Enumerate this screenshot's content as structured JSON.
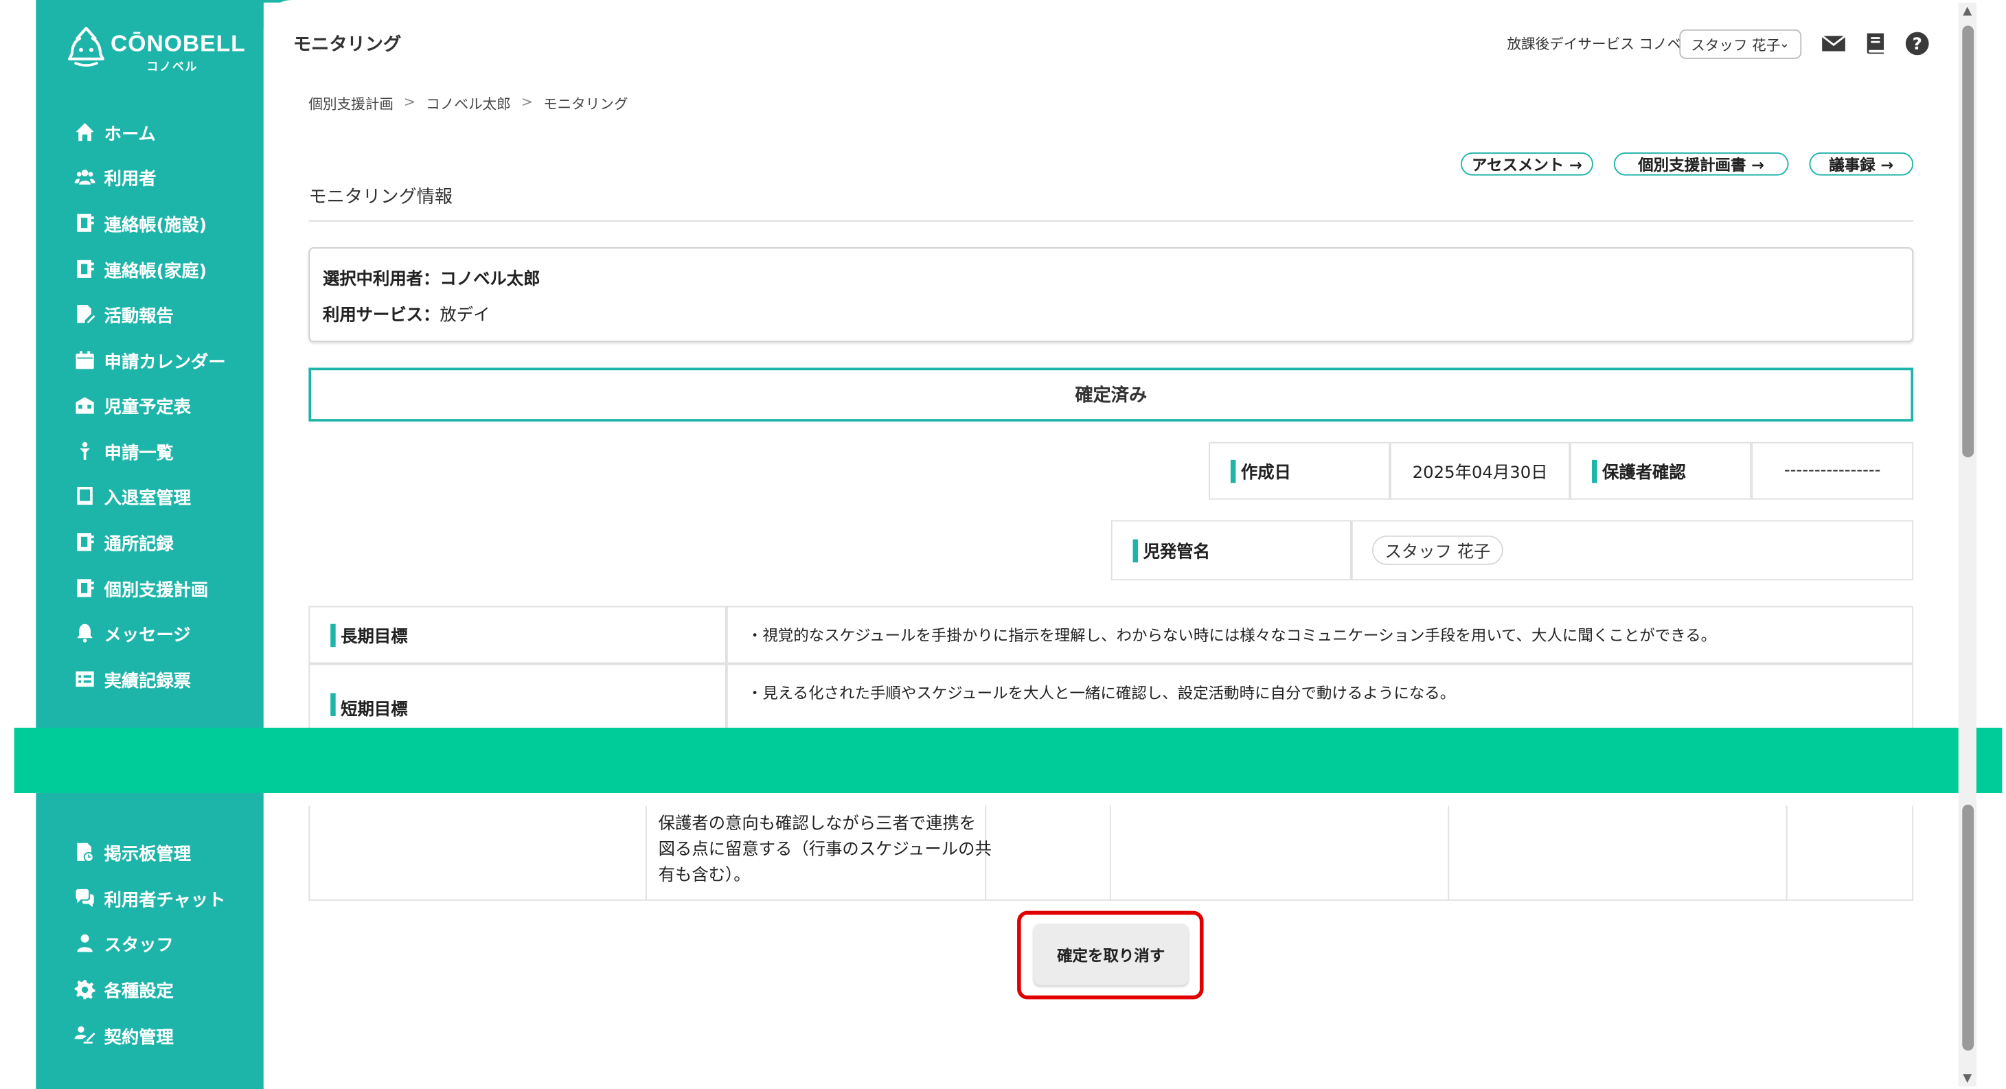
{
  "brand": {
    "name": "CŌNOBELL",
    "kana": "コノベル"
  },
  "colors": {
    "accent": "#1db4aa",
    "banner": "#00cc99",
    "highlight": "#e00000"
  },
  "sidebar": {
    "items": [
      {
        "label": "ホーム",
        "icon": "home-icon"
      },
      {
        "label": "利用者",
        "icon": "users-icon"
      },
      {
        "label": "連絡帳(施設)",
        "icon": "contact-book-icon"
      },
      {
        "label": "連絡帳(家庭)",
        "icon": "contact-book-icon"
      },
      {
        "label": "活動報告",
        "icon": "report-edit-icon"
      },
      {
        "label": "申請カレンダー",
        "icon": "calendar-icon"
      },
      {
        "label": "児童予定表",
        "icon": "schedule-icon"
      },
      {
        "label": "申請一覧",
        "icon": "request-list-icon"
      },
      {
        "label": "入退室管理",
        "icon": "tablet-icon"
      },
      {
        "label": "通所記録",
        "icon": "contact-book-icon"
      },
      {
        "label": "個別支援計画",
        "icon": "contact-book-icon"
      },
      {
        "label": "メッセージ",
        "icon": "bell-icon"
      },
      {
        "label": "実績記録票",
        "icon": "table-icon"
      },
      {
        "label": "掲示板管理",
        "icon": "bulletin-icon"
      },
      {
        "label": "利用者チャット",
        "icon": "chat-icon"
      },
      {
        "label": "スタッフ",
        "icon": "staff-icon"
      },
      {
        "label": "各種設定",
        "icon": "gear-icon"
      },
      {
        "label": "契約管理",
        "icon": "contract-icon"
      }
    ]
  },
  "header": {
    "title": "モニタリング",
    "facility": "放課後デイサービス コノベル",
    "staff_selected": "スタッフ 花子",
    "icons": [
      "mail-icon",
      "book-icon",
      "help-icon"
    ]
  },
  "breadcrumb": [
    "個別支援計画",
    "コノベル太郎",
    "モニタリング"
  ],
  "links": {
    "assessment": "アセスメント →",
    "support_plan": "個別支援計画書 →",
    "minutes": "議事録 →"
  },
  "section": {
    "title": "モニタリング情報"
  },
  "user_info": {
    "user_label": "選択中利用者：",
    "user_name": "コノベル太郎",
    "service_label": "利用サービス：",
    "service_value": "放デイ"
  },
  "status": "確定済み",
  "meta": {
    "created_label": "作成日",
    "created_value": "2025年04月30日",
    "guardian_label": "保護者確認",
    "guardian_value": "----------------",
    "manager_label": "児発管名",
    "manager_value": "スタッフ 花子"
  },
  "goals": {
    "long_label": "長期目標",
    "long_text": "・視覚的なスケジュールを手掛かりに指示を理解し、わからない時には様々なコミュニケーション手段を用いて、大人に聞くことができる。",
    "short_label": "短期目標",
    "short_text": "・見える化された手順やスケジュールを大人と一緒に確認し、設定活動時に自分で動けるようになる。"
  },
  "consent_text": [
    "保護者の意向も確認しながら三者で連携を",
    "図る点に留意する（行事のスケジュールの共",
    "有も含む）。"
  ],
  "actions": {
    "undo_confirm": "確定を取り消す"
  }
}
